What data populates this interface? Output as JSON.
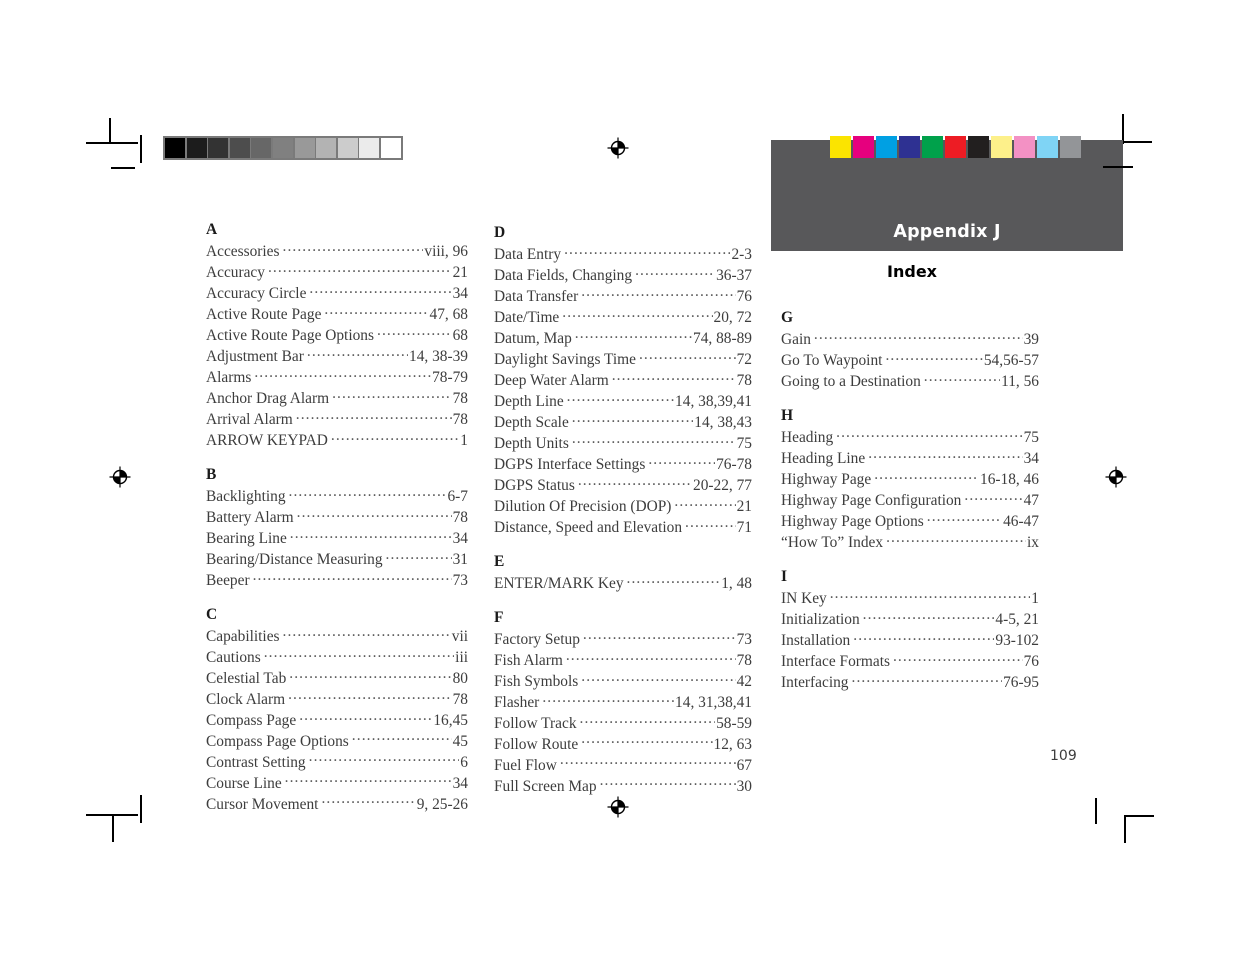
{
  "header": {
    "appendix_label": "Appendix J",
    "index_label": "Index",
    "block_color": "#58585a"
  },
  "page_number": "109",
  "calibration": {
    "grayscale_patches": [
      "#000000",
      "#1c1c1c",
      "#333333",
      "#4d4d4d",
      "#676767",
      "#808080",
      "#999999",
      "#b3b3b3",
      "#cccccc",
      "#ebebeb",
      "#ffffff"
    ],
    "color_swatches": [
      {
        "name": "yellow",
        "hex": "#fbe400"
      },
      {
        "name": "magenta",
        "hex": "#e6007e"
      },
      {
        "name": "cyan",
        "hex": "#00a0e3"
      },
      {
        "name": "violet-blue",
        "hex": "#2e3192"
      },
      {
        "name": "green",
        "hex": "#00a14b"
      },
      {
        "name": "red",
        "hex": "#ed1c24"
      },
      {
        "name": "black",
        "hex": "#221f1f"
      },
      {
        "name": "light-yellow",
        "hex": "#fdf08a"
      },
      {
        "name": "pink",
        "hex": "#f391c4"
      },
      {
        "name": "light-blue",
        "hex": "#7fd4f5"
      },
      {
        "name": "gray",
        "hex": "#939598"
      }
    ]
  },
  "columns": [
    {
      "id": "col-1",
      "sections": [
        {
          "letter": "A",
          "entries": [
            {
              "label": "Accessories",
              "pages": "viii, 96"
            },
            {
              "label": "Accuracy",
              "pages": "21"
            },
            {
              "label": "Accuracy Circle",
              "pages": "34"
            },
            {
              "label": "Active Route Page",
              "pages": "47, 68"
            },
            {
              "label": "Active Route Page Options",
              "pages": "68"
            },
            {
              "label": "Adjustment Bar",
              "pages": "14, 38-39"
            },
            {
              "label": "Alarms",
              "pages": "78-79"
            },
            {
              "label": "Anchor Drag Alarm",
              "pages": "78"
            },
            {
              "label": "Arrival Alarm",
              "pages": "78"
            },
            {
              "label": "ARROW KEYPAD",
              "pages": "1"
            }
          ]
        },
        {
          "letter": "B",
          "entries": [
            {
              "label": "Backlighting",
              "pages": "6-7"
            },
            {
              "label": "Battery Alarm",
              "pages": "78"
            },
            {
              "label": "Bearing Line",
              "pages": "34"
            },
            {
              "label": "Bearing/Distance Measuring",
              "pages": "31"
            },
            {
              "label": "Beeper",
              "pages": "73"
            }
          ]
        },
        {
          "letter": "C",
          "entries": [
            {
              "label": "Capabilities",
              "pages": "vii"
            },
            {
              "label": "Cautions",
              "pages": "iii"
            },
            {
              "label": "Celestial Tab",
              "pages": "80"
            },
            {
              "label": "Clock Alarm",
              "pages": "78"
            },
            {
              "label": "Compass Page",
              "pages": "16,45"
            },
            {
              "label": "Compass Page Options",
              "pages": "45"
            },
            {
              "label": "Contrast  Setting",
              "pages": "6"
            },
            {
              "label": "Course  Line",
              "pages": "34"
            },
            {
              "label": "Cursor Movement",
              "pages": "9, 25-26"
            }
          ]
        }
      ]
    },
    {
      "id": "col-2",
      "sections": [
        {
          "letter": "D",
          "entries": [
            {
              "label": "Data Entry",
              "pages": "2-3"
            },
            {
              "label": "Data Fields, Changing",
              "pages": "36-37"
            },
            {
              "label": "Data Transfer",
              "pages": "76"
            },
            {
              "label": "Date/Time",
              "pages": "20, 72"
            },
            {
              "label": "Datum, Map",
              "pages": "74, 88-89"
            },
            {
              "label": "Daylight Savings Time",
              "pages": "72"
            },
            {
              "label": "Deep Water Alarm",
              "pages": "78"
            },
            {
              "label": "Depth Line",
              "pages": "14, 38,39,41"
            },
            {
              "label": "Depth Scale",
              "pages": "14, 38,43"
            },
            {
              "label": "Depth Units",
              "pages": "75"
            },
            {
              "label": "DGPS Interface Settings",
              "pages": "76-78"
            },
            {
              "label": "DGPS Status",
              "pages": "20-22, 77"
            },
            {
              "label": "Dilution Of Precision (DOP)",
              "pages": "21"
            },
            {
              "label": "Distance, Speed and Elevation",
              "pages": "71"
            }
          ]
        },
        {
          "letter": "E",
          "entries": [
            {
              "label": "ENTER/MARK Key",
              "pages": "1, 48"
            }
          ]
        },
        {
          "letter": "F",
          "entries": [
            {
              "label": "Factory Setup",
              "pages": "73"
            },
            {
              "label": "Fish Alarm",
              "pages": "78"
            },
            {
              "label": "Fish Symbols",
              "pages": "42"
            },
            {
              "label": "Flasher",
              "pages": "14, 31,38,41"
            },
            {
              "label": "Follow Track",
              "pages": "58-59"
            },
            {
              "label": "Follow Route",
              "pages": "12, 63"
            },
            {
              "label": "Fuel Flow",
              "pages": "67"
            },
            {
              "label": "Full Screen Map",
              "pages": "30"
            }
          ]
        }
      ]
    },
    {
      "id": "col-3",
      "sections": [
        {
          "letter": "G",
          "entries": [
            {
              "label": "Gain",
              "pages": "39"
            },
            {
              "label": "Go To Waypoint",
              "pages": "54,56-57"
            },
            {
              "label": "Going to a Destination",
              "pages": "11, 56"
            }
          ]
        },
        {
          "letter": "H",
          "entries": [
            {
              "label": "Heading",
              "pages": "75"
            },
            {
              "label": "Heading Line",
              "pages": "34"
            },
            {
              "label": "Highway Page",
              "pages": "16-18, 46"
            },
            {
              "label": "Highway Page Configuration",
              "pages": "47"
            },
            {
              "label": "Highway Page Options",
              "pages": "46-47"
            },
            {
              "label": "“How To” Index",
              "pages": "ix"
            }
          ]
        },
        {
          "letter": "I",
          "entries": [
            {
              "label": "IN Key",
              "pages": "1"
            },
            {
              "label": "Initialization",
              "pages": "4-5, 21"
            },
            {
              "label": "Installation",
              "pages": "93-102"
            },
            {
              "label": "Interface Formats",
              "pages": "76"
            },
            {
              "label": "Interfacing",
              "pages": "76-95"
            }
          ]
        }
      ]
    }
  ]
}
